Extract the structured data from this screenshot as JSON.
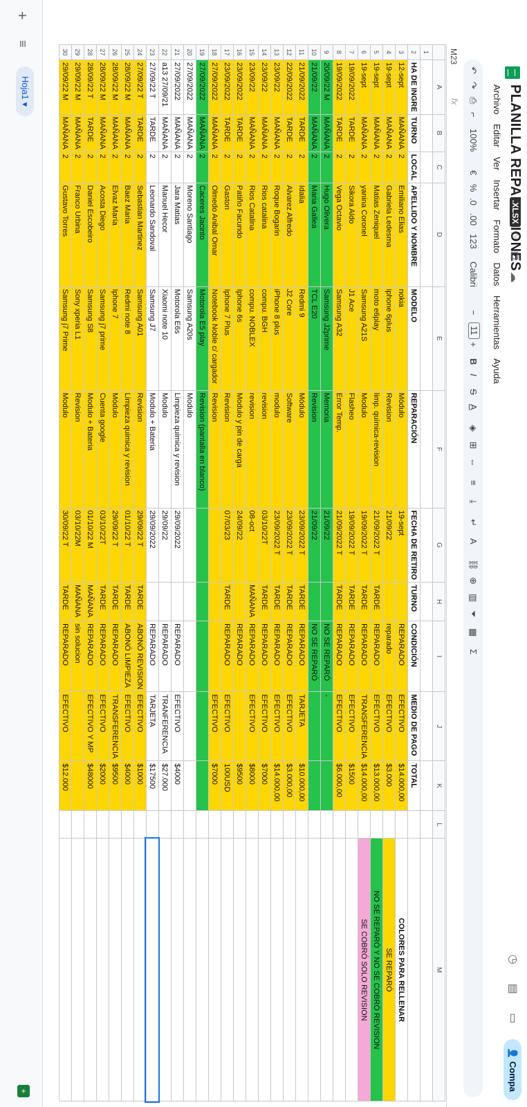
{
  "app": {
    "title": "PLANILLA REPARACIONES",
    "extension": ".XLSX",
    "menu": [
      "Archivo",
      "Editar",
      "Ver",
      "Insertar",
      "Formato",
      "Datos",
      "Herramientas",
      "Ayuda"
    ],
    "share_label": "Compa"
  },
  "toolbar": {
    "zoom": "100%",
    "currency": "€",
    "percent": "%",
    "dec_less": ".0",
    "dec_more": ".00",
    "format_123": "123",
    "font": "Calibri",
    "minus": "−",
    "font_size": "11",
    "plus": "+",
    "bold": "B",
    "italic": "I",
    "strike": "S",
    "underline_a": "A"
  },
  "formula_bar": {
    "cell_ref": "M23",
    "fx": "fx"
  },
  "columns": [
    "",
    "A",
    "B",
    "C",
    "D",
    "E",
    "F",
    "G",
    "H",
    "I",
    "J",
    "K",
    "L",
    "M"
  ],
  "headers": [
    "HA DE INGRE",
    "TURNO",
    "LOCAL",
    "APELLIDO Y NOMBRE",
    "MODELO",
    "REPARACIÓN",
    "FECHA DE RETIRO",
    "TURNO",
    "CONDICIÓN",
    "MEDIO DE PAGO",
    "TOTAL"
  ],
  "rows": [
    {
      "n": "3",
      "color": "yellow",
      "cells": [
        "12-sept",
        "MAÑANA",
        "2",
        "Emiliano Elias",
        "nokia",
        "Módulo",
        "19-sept",
        "",
        "REPARADO",
        "EFECTIVO",
        "$14.000,00"
      ]
    },
    {
      "n": "4",
      "color": "yellow",
      "cells": [
        "19-sept",
        "MAÑANA",
        "2",
        "Gabriela Ledesma",
        "iphone 6plus",
        "Revision",
        "21/09/22",
        "",
        "reparado",
        "EFECTIVO",
        "$3.000"
      ]
    },
    {
      "n": "5",
      "color": "yellow",
      "cells": [
        "19-sept",
        "MAÑANA",
        "2",
        "Matias Zeniquel",
        "moto e6play",
        "limp. química-revision",
        "21/09/2022 T",
        "TARDE",
        "REPARADO",
        "EFECTIVO",
        "$13.000,00"
      ]
    },
    {
      "n": "6",
      "color": "yellow",
      "cells": [
        "19-sept",
        "MAÑANA",
        "2",
        "yanina Coronel",
        "Samsung A21S",
        "Modulo",
        "19/09/2022 T",
        "TARDE",
        "REPARADO",
        "TRANSFERENCIA",
        "$14.000,00"
      ]
    },
    {
      "n": "7",
      "color": "yellow",
      "cells": [
        "19/09/2022",
        "TARDE",
        "2",
        "Sikora Aldo",
        "J1 Ace",
        "Flasheo",
        "19/09/2022 T",
        "TARDE",
        "REPARADO",
        "EFECTIVO",
        "$1500"
      ]
    },
    {
      "n": "8",
      "color": "yellow",
      "cells": [
        "19/09/2022",
        "TARDE",
        "2",
        "Vega Octavio",
        "Samsung A32",
        "Error Temp.",
        "21/09/2022 T",
        "TARDE",
        "REPARADO",
        "EFECTIVO",
        "$6.000,00"
      ]
    },
    {
      "n": "9",
      "color": "green",
      "cells": [
        "20/09/22 M",
        "MAÑANA",
        "2",
        "Hugo Olivera",
        "Samsung J2prime",
        "Memoria",
        "21/09/22",
        "",
        "NO SE REPARÓ",
        "-",
        ""
      ]
    },
    {
      "n": "10",
      "color": "green",
      "cells": [
        "21/09/22",
        "MAÑANA",
        "2",
        "Maria Gallea",
        "TCL E20",
        "Revision",
        "21/09/22",
        "",
        "NO SE REPARÓ",
        "",
        ""
      ]
    },
    {
      "n": "11",
      "color": "yellow",
      "cells": [
        "21/09/2022",
        "TARDE",
        "2",
        "Idalia",
        "Redmi 9",
        "Módulo",
        "23/09/2022 T",
        "TARDE",
        "REPARADO",
        "TARJETA",
        "$10.000,00"
      ]
    },
    {
      "n": "12",
      "color": "yellow",
      "cells": [
        "22/09/2022",
        "TARDE",
        "2",
        "Alvarez Alfredo",
        "J2 Core",
        "Software",
        "23/09/2022 T",
        "TARDE",
        "REPARADO",
        "EFECTIVO",
        "$3.000,00"
      ]
    },
    {
      "n": "13",
      "color": "yellow",
      "cells": [
        "23/09/22",
        "MAÑANA",
        "2",
        "Roque Bogarin",
        "iPhone 8 plus",
        "modulo",
        "23/09/2022 T",
        "TARDE",
        "REPARADO",
        "EFECTIVO",
        "$14.000,00"
      ]
    },
    {
      "n": "14",
      "color": "yellow",
      "cells": [
        "23/09/22",
        "MAÑANA",
        "2",
        "Rios catalina",
        "compu. BGH",
        "revision",
        "03/10/22T",
        "TARDE",
        "REPARADO",
        "EFECTIVO",
        "$7000"
      ]
    },
    {
      "n": "15",
      "color": "yellow",
      "cells": [
        "23/09/22",
        "MAÑANA",
        "2",
        "Rios Catalina",
        "compu. NOBLEX",
        "revision",
        "08-oct",
        "MAÑANA",
        "REPARADO",
        "EFECTIVO",
        "$8000"
      ]
    },
    {
      "n": "16",
      "color": "yellow",
      "cells": [
        "23/09/2022",
        "TARDE",
        "2",
        "Patiño Facundo",
        "Iphone 6s",
        "Modulo y pin de carga",
        "24/09/22",
        "",
        "REPARADO",
        "",
        "$9500"
      ]
    },
    {
      "n": "17",
      "color": "yellow",
      "cells": [
        "23/09/2022",
        "TARDE",
        "2",
        "Gaston",
        "Iphone 7 Plus",
        "Revision",
        "07/03/23",
        "TARDE",
        "REPARADO",
        "EFECTIVO",
        "100USD"
      ]
    },
    {
      "n": "18",
      "color": "yellow",
      "cells": [
        "27/09/2022",
        "MAÑANA",
        "2",
        "Olmedo Anibal Omar",
        "Notebook Noble c/ cargador",
        "Revision",
        "",
        "",
        "",
        "EFECTIVO",
        "$7000"
      ]
    },
    {
      "n": "19",
      "color": "green",
      "cells": [
        "27/09/2022",
        "MAÑANA",
        "2",
        "Caceres Jacinto",
        "Motorola E5 play",
        "Revision (pantalla en blanco)",
        "",
        "",
        "",
        "",
        ""
      ]
    },
    {
      "n": "20",
      "color": "white",
      "cells": [
        "27/09/2022",
        "MAÑANA",
        "2",
        "Moreno Santiago",
        "Samsung A20s",
        "Modulo",
        "",
        "",
        "",
        "",
        ""
      ]
    },
    {
      "n": "21",
      "color": "white",
      "cells": [
        "27/09/2022",
        "MAÑANA",
        "2",
        "Jara Matias",
        "Motorola E6s",
        "Limpieza quimica y revision",
        "29/09/2022",
        "",
        "REPARADO",
        "EFECTIVO",
        "$4000"
      ]
    },
    {
      "n": "22",
      "color": "white",
      "cells": [
        "a13 27/09/21",
        "MAÑANA",
        "2",
        "Manuel Hecor",
        "Xiaomi note 10",
        "Modulo",
        "29/09/22",
        "",
        "REPARADO",
        "TRANFERENCIA",
        "$27.000"
      ]
    },
    {
      "n": "23",
      "color": "white",
      "cells": [
        "27/09/22 T",
        "TARDE",
        "2",
        "Leonardo Sandoval",
        "Samsung J7",
        "Modulo + Bateria",
        "29/09/2022",
        "",
        "REPARADO",
        "TARJETA",
        "$17500"
      ]
    },
    {
      "n": "24",
      "color": "yellow",
      "cells": [
        "27/09/22 T",
        "TARDE",
        "2",
        "Sebastian Martinez",
        "Samsung A01",
        "Revision",
        "29/09/22 T",
        "TARDE",
        "ABONÓ REVISION",
        "EFECTIVO",
        "$1000"
      ]
    },
    {
      "n": "25",
      "color": "yellow",
      "cells": [
        "28/09/22 M",
        "MAÑANA",
        "2",
        "Baez Maria",
        "Redmi note 8",
        "Limpieza quimica y revision",
        "01/10/22 T",
        "TARDE",
        "ABONÓ LIMPIEZA",
        "EFECTIVO",
        "$4000"
      ]
    },
    {
      "n": "26",
      "color": "yellow",
      "cells": [
        "28/09/22 M",
        "MAÑANA",
        "2",
        "Elvaz María",
        "Iphone 7",
        "Módulo",
        "29/09/22 T",
        "TARDE",
        "REPARADO",
        "TRANSFERENCIA",
        "$9500"
      ]
    },
    {
      "n": "27",
      "color": "yellow",
      "cells": [
        "28/09/22 M",
        "MAÑANA",
        "2",
        "Acosta Diego",
        "Samsung j7 prime",
        "Cuenta google",
        "03/10/22T",
        "TARDE",
        "REPARADO",
        "EFECTIVO",
        "$2000"
      ]
    },
    {
      "n": "28",
      "color": "yellow",
      "cells": [
        "28/09/22 T",
        "TARDE",
        "2",
        "Daniel Escobeiro",
        "Samsung S8",
        "Modulo + Bateria",
        "01/10/22 M",
        "MAÑANA",
        "REPARADO",
        "EFECTIVO Y MP",
        "$48000"
      ]
    },
    {
      "n": "29",
      "color": "yellow",
      "cells": [
        "29/09/22 M",
        "MAÑANA",
        "2",
        "Franco Urbina",
        "Sony xperia L1",
        "Revision",
        "03/10/22M",
        "MAÑANA",
        "sin solucion",
        "",
        ""
      ]
    },
    {
      "n": "30",
      "color": "yellow",
      "cells": [
        "29/09/22 M",
        "MAÑANA",
        "2",
        "Gustavo Torres",
        "Samsung j7 Prime",
        "Modulo",
        "30/09/22 T",
        "TARDE",
        "REPARADO",
        "EFECTIVO",
        "$12.000"
      ]
    }
  ],
  "legend": {
    "title": "COLORES PARA RELLENAR",
    "items": [
      {
        "text": "SE REPARÓ",
        "color": "#ffd600"
      },
      {
        "text": "NO SE REPARÓ Y NO SE COBRÓ REVISION",
        "color": "#27c24c"
      },
      {
        "text": "SE COBRÓ SOLO REVISION",
        "color": "#f4a9d6"
      }
    ]
  },
  "bottom": {
    "add": "+",
    "all_sheets": "≡",
    "sheet_tab": "Hoja1 ▾"
  }
}
